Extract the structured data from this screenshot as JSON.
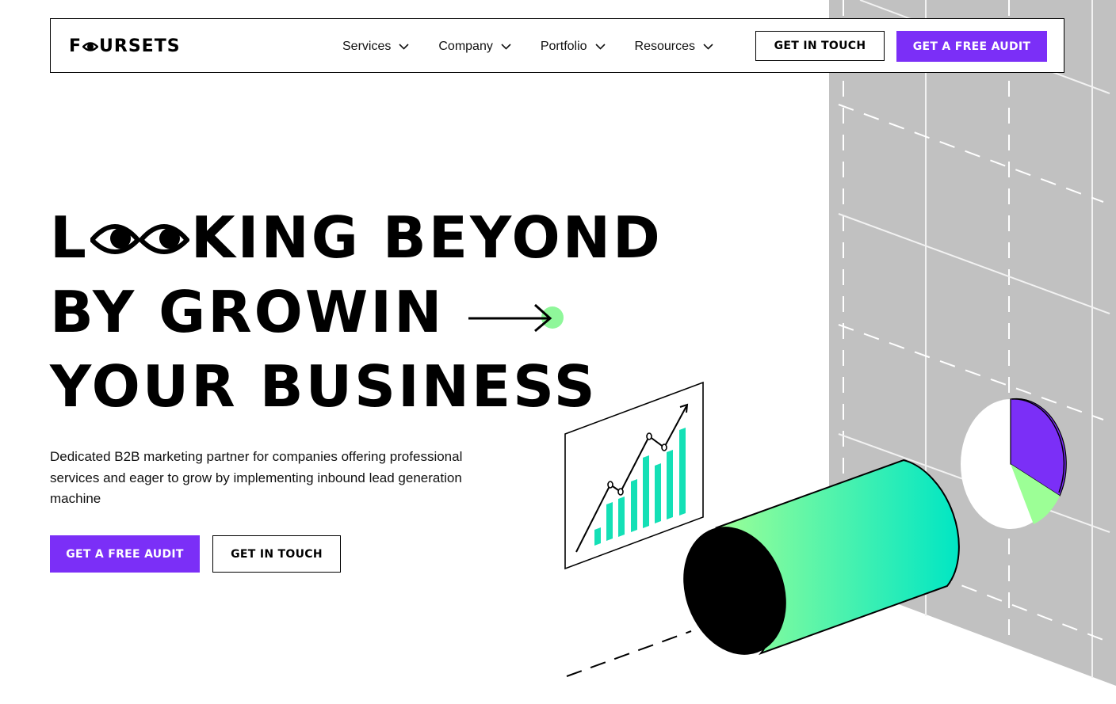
{
  "brand": {
    "name": "FOURSETS",
    "name_before": "F",
    "name_after": "URSETS"
  },
  "nav": {
    "items": [
      {
        "label": "Services"
      },
      {
        "label": "Company"
      },
      {
        "label": "Portfolio"
      },
      {
        "label": "Resources"
      }
    ],
    "get_in_touch_label": "GET IN TOUCH",
    "free_audit_label": "GET A FREE AUDIT"
  },
  "hero": {
    "headline_full": "LOOKING BEYOND BY GROWIN YOUR BUSINESS",
    "line1_start": "L",
    "line1_end": "KING BEYOND",
    "line2": "BY GROWIN",
    "line3": "YOUR BUSINESS",
    "description": "Dedicated B2B marketing partner for companies offering professional services and eager to grow by implementing inbound lead generation machine",
    "primary_cta": "GET A FREE AUDIT",
    "secondary_cta": "GET IN TOUCH"
  },
  "colors": {
    "accent_purple": "#7b2ff7",
    "accent_green": "#8ff79a",
    "accent_teal": "#00e0c0",
    "wall_gray": "#c1c1c1"
  },
  "icons": [
    "eye-logo-icon",
    "chevron-down-icon",
    "eyes-icon",
    "arrow-right-icon",
    "growth-chart-icon",
    "pie-chart-icon",
    "cylinder-icon"
  ]
}
